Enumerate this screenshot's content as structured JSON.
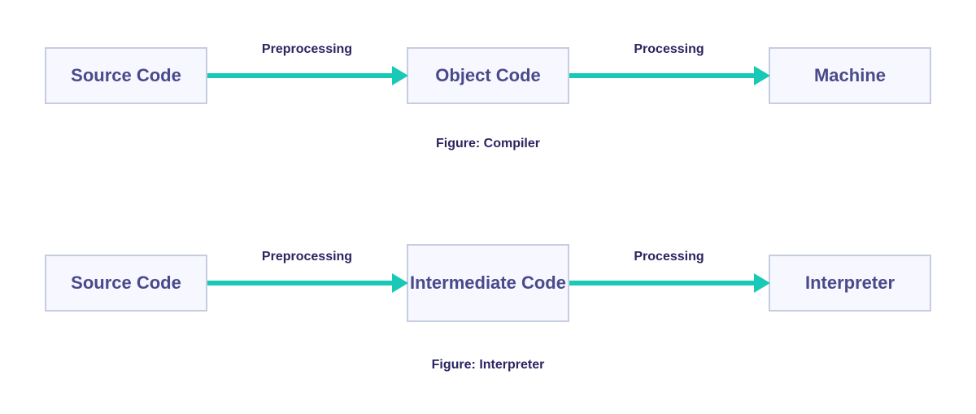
{
  "colors": {
    "node_bg": "#f6f7ff",
    "node_border": "#c7cde0",
    "node_text": "#4a4a8a",
    "arrow": "#18c9b7",
    "caption": "#2b2560"
  },
  "rows": [
    {
      "nodes": [
        "Source Code",
        "Object Code",
        "Machine"
      ],
      "arrows": [
        "Preprocessing",
        "Processing"
      ],
      "caption": "Figure: Compiler"
    },
    {
      "nodes": [
        "Source Code",
        "Intermediate Code",
        "Interpreter"
      ],
      "arrows": [
        "Preprocessing",
        "Processing"
      ],
      "caption": "Figure: Interpreter"
    }
  ]
}
